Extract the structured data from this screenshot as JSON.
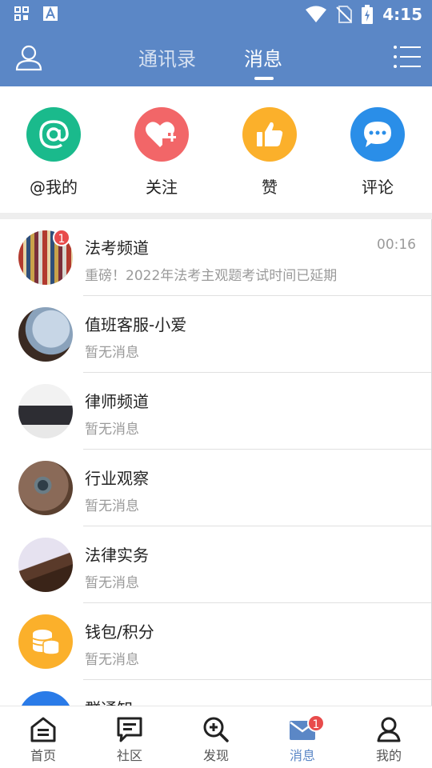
{
  "status_bar": {
    "time": "4:15"
  },
  "header": {
    "tabs": [
      {
        "label": "通讯录"
      },
      {
        "label": "消息"
      }
    ],
    "active_tab": "消息"
  },
  "quick_actions": [
    {
      "label": "@我的",
      "icon": "at-icon",
      "color": "#1aba8c"
    },
    {
      "label": "关注",
      "icon": "heart-plus-icon",
      "color": "#f26668"
    },
    {
      "label": "赞",
      "icon": "thumbs-up-icon",
      "color": "#fbb02b"
    },
    {
      "label": "评论",
      "icon": "chat-bubble-icon",
      "color": "#2a8ee8"
    }
  ],
  "messages": [
    {
      "title": "法考频道",
      "subtitle": "重磅！2022年法考主观题考试时间已延期",
      "time": "00:16",
      "badge": "1"
    },
    {
      "title": "值班客服-小爱",
      "subtitle": "暂无消息"
    },
    {
      "title": "律师频道",
      "subtitle": "暂无消息"
    },
    {
      "title": "行业观察",
      "subtitle": "暂无消息"
    },
    {
      "title": "法律实务",
      "subtitle": "暂无消息"
    },
    {
      "title": "钱包/积分",
      "subtitle": "暂无消息"
    },
    {
      "title": "群通知",
      "subtitle": ""
    }
  ],
  "bottom_nav": [
    {
      "label": "首页",
      "icon": "home-icon"
    },
    {
      "label": "社区",
      "icon": "community-icon"
    },
    {
      "label": "发现",
      "icon": "discover-icon"
    },
    {
      "label": "消息",
      "icon": "mail-icon",
      "badge": "1",
      "active": true
    },
    {
      "label": "我的",
      "icon": "profile-icon"
    }
  ],
  "colors": {
    "primary": "#5b87c6",
    "badge": "#e84b4b",
    "muted": "#9a9a9a"
  }
}
